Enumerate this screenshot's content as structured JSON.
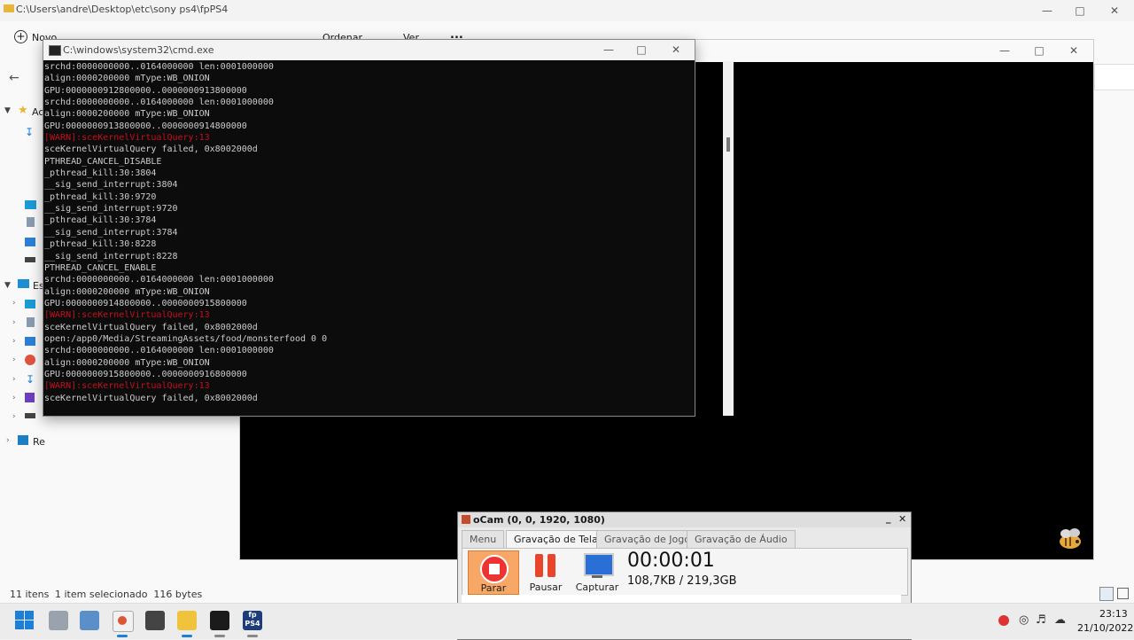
{
  "explorer": {
    "path": "C:\\Users\\andre\\Desktop\\etc\\sony ps4\\fpPS4",
    "toolbar": {
      "new_label": "Novo",
      "sort_label": "Ordenar",
      "view_label": "Ver",
      "more_label": "..."
    },
    "nav": {
      "items": [
        "Ac",
        "",
        "",
        "",
        "",
        "Es",
        "",
        "",
        "",
        "",
        "",
        "",
        "",
        "",
        "Re"
      ]
    },
    "status": {
      "count": "11 itens",
      "selection": "1 item selecionado  116 bytes"
    }
  },
  "cmd": {
    "title": "C:\\windows\\system32\\cmd.exe",
    "lines": [
      {
        "text": "srchd:0000000000..0164000000 len:0001000000",
        "warn": false
      },
      {
        "text": "align:0000200000 mType:WB_ONION",
        "warn": false
      },
      {
        "text": "GPU:0000000912800000..0000000913800000",
        "warn": false
      },
      {
        "text": "srchd:0000000000..0164000000 len:0001000000",
        "warn": false
      },
      {
        "text": "align:0000200000 mType:WB_ONION",
        "warn": false
      },
      {
        "text": "GPU:0000000913800000..0000000914800000",
        "warn": false
      },
      {
        "text": "[WARN]:sceKernelVirtualQuery:13",
        "warn": true
      },
      {
        "text": "sceKernelVirtualQuery failed, 0x8002000d",
        "warn": false
      },
      {
        "text": "PTHREAD_CANCEL_DISABLE",
        "warn": false
      },
      {
        "text": "_pthread_kill:30:3804",
        "warn": false
      },
      {
        "text": "__sig_send_interrupt:3804",
        "warn": false
      },
      {
        "text": "_pthread_kill:30:9720",
        "warn": false
      },
      {
        "text": "__sig_send_interrupt:9720",
        "warn": false
      },
      {
        "text": "_pthread_kill:30:3784",
        "warn": false
      },
      {
        "text": "__sig_send_interrupt:3784",
        "warn": false
      },
      {
        "text": "_pthread_kill:30:8228",
        "warn": false
      },
      {
        "text": "__sig_send_interrupt:8228",
        "warn": false
      },
      {
        "text": "PTHREAD_CANCEL_ENABLE",
        "warn": false
      },
      {
        "text": "srchd:0000000000..0164000000 len:0001000000",
        "warn": false
      },
      {
        "text": "align:0000200000 mType:WB_ONION",
        "warn": false
      },
      {
        "text": "GPU:0000000914800000..0000000915800000",
        "warn": false
      },
      {
        "text": "[WARN]:sceKernelVirtualQuery:13",
        "warn": true
      },
      {
        "text": "sceKernelVirtualQuery failed, 0x8002000d",
        "warn": false
      },
      {
        "text": "open:/app0/Media/StreamingAssets/food/monsterfood 0 0",
        "warn": false
      },
      {
        "text": "srchd:0000000000..0164000000 len:0001000000",
        "warn": false
      },
      {
        "text": "align:0000200000 mType:WB_ONION",
        "warn": false
      },
      {
        "text": "GPU:0000000915800000..0000000916800000",
        "warn": false
      },
      {
        "text": "[WARN]:sceKernelVirtualQuery:13",
        "warn": true
      },
      {
        "text": "sceKernelVirtualQuery failed, 0x8002000d",
        "warn": false
      }
    ]
  },
  "ocam": {
    "title": "oCam (0, 0, 1920, 1080)",
    "tabs": [
      "Menu",
      "Gravação de Tela",
      "Gravação de Jogo",
      "Gravação de Áudio"
    ],
    "active_tab": "Gravação de Tela",
    "buttons": {
      "stop": "Parar",
      "pause": "Pausar",
      "capture": "Capturar"
    },
    "timer": "00:00:01",
    "size": "108,7KB / 219,3GB"
  },
  "taskbar": {
    "time": "23:13",
    "date": "21/10/2022",
    "fpps4_label_top": "fp",
    "fpps4_label_bottom": "PS4"
  },
  "colors": {
    "warn": "#c50f1f",
    "cmd_bg": "#0c0c0c",
    "stop_button": "#f4a460"
  }
}
